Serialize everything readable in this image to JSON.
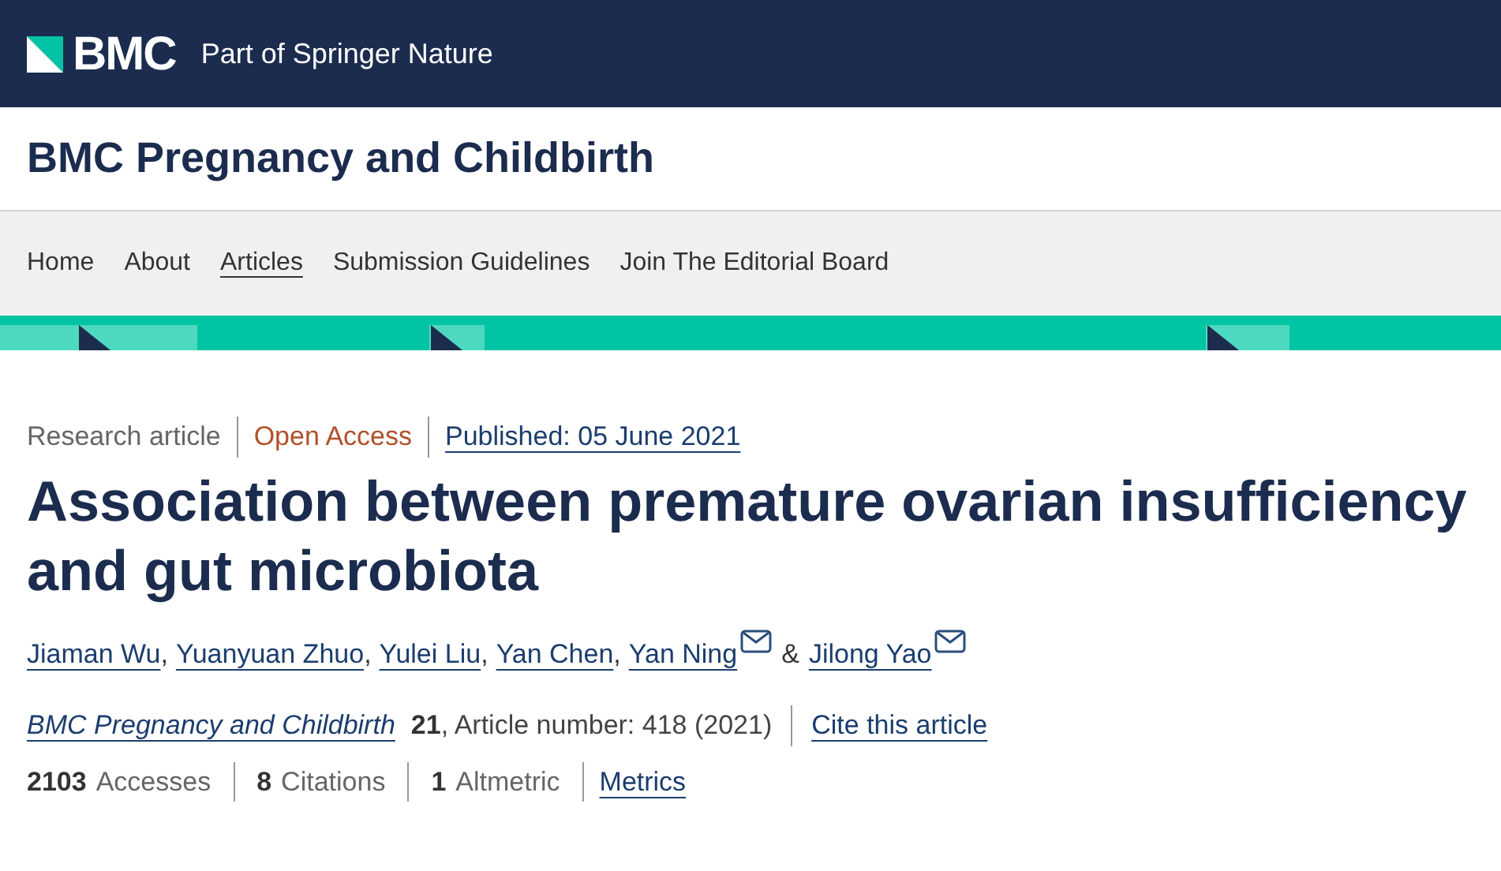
{
  "header": {
    "logo": "BMC",
    "tagline": "Part of Springer Nature"
  },
  "journal_title": "BMC Pregnancy and Childbirth",
  "nav": [
    {
      "label": "Home",
      "selected": false
    },
    {
      "label": "About",
      "selected": false
    },
    {
      "label": "Articles",
      "selected": true
    },
    {
      "label": "Submission Guidelines",
      "selected": false
    },
    {
      "label": "Join The Editorial Board",
      "selected": false
    }
  ],
  "article_type": "Research article",
  "access": "Open Access",
  "published": "Published: 05 June 2021",
  "title": "Association between premature ovarian insufficiency and gut microbiota",
  "authors": [
    {
      "name": "Jiaman Wu",
      "email": false,
      "after": ","
    },
    {
      "name": "Yuanyuan Zhuo",
      "email": false,
      "after": ","
    },
    {
      "name": "Yulei Liu",
      "email": false,
      "after": ","
    },
    {
      "name": "Yan Chen",
      "email": false,
      "after": ","
    },
    {
      "name": "Yan Ning",
      "email": true,
      "after": "&"
    },
    {
      "name": "Jilong Yao",
      "email": true
    }
  ],
  "citation": {
    "journal": "BMC Pregnancy and Childbirth",
    "volume": "21",
    "details": ", Article number: 418 (2021)",
    "cite_link": "Cite this article"
  },
  "metrics": [
    {
      "count": "2103",
      "metric": "Accesses"
    },
    {
      "count": "8",
      "metric": "Citations"
    },
    {
      "count": "1",
      "metric": "Altmetric"
    }
  ],
  "metrics_link": "Metrics"
}
